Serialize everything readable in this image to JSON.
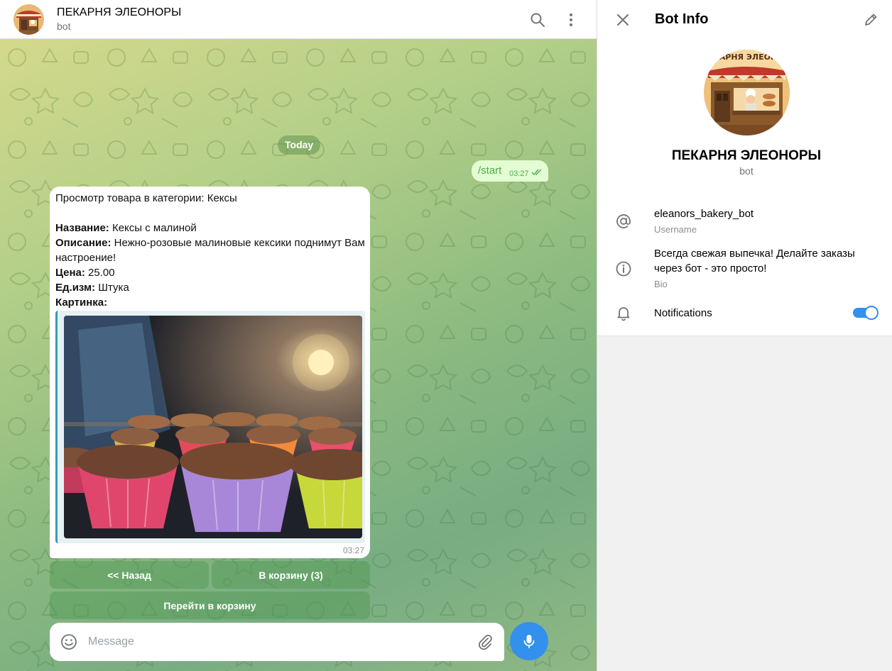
{
  "chat": {
    "title": "ПЕКАРНЯ ЭЛЕОНОРЫ",
    "subtitle": "bot",
    "date_chip": "Today",
    "outgoing": {
      "text": "/start",
      "time": "03:27"
    },
    "incoming": {
      "line1": "Просмотр товара в категории: Кексы",
      "name_label": "Название:",
      "name_value": " Кексы с малиной",
      "desc_label": "Описание:",
      "desc_value": " Нежно-розовые малиновые кексики поднимут Вам настроение!",
      "price_label": "Цена:",
      "price_value": " 25.00",
      "unit_label": "Ед.изм:",
      "unit_value": " Штука",
      "picture_label": "Картинка:",
      "time": "03:27"
    },
    "keyboard": {
      "back": "<< Назад",
      "add_to_cart": "В корзину (3)",
      "go_to_cart": "Перейти в корзину"
    },
    "composer": {
      "placeholder": "Message"
    }
  },
  "info": {
    "title": "Bot Info",
    "name": "ПЕКАРНЯ ЭЛЕОНОРЫ",
    "subtitle": "bot",
    "username": "eleanors_bakery_bot",
    "username_label": "Username",
    "bio": "Всегда свежая выпечка! Делайте заказы через бот - это просто!",
    "bio_label": "Bio",
    "notifications_label": "Notifications",
    "notifications_on": true,
    "avatar_sign": "ПЕКАРНЯ ЭЛЕОНОРЫ"
  },
  "colors": {
    "accent": "#3390ec",
    "outgoing_bubble": "#e3fcd3",
    "outgoing_text": "#4fae4e",
    "keyboard_button": "#6fa870"
  },
  "icons": {
    "header": [
      "search-icon",
      "more-vertical-icon"
    ],
    "info": [
      "close-icon",
      "edit-pencil-icon",
      "at-sign-icon",
      "info-circle-icon",
      "bell-icon"
    ],
    "composer": [
      "emoji-smile-icon",
      "paperclip-icon",
      "microphone-icon"
    ]
  }
}
